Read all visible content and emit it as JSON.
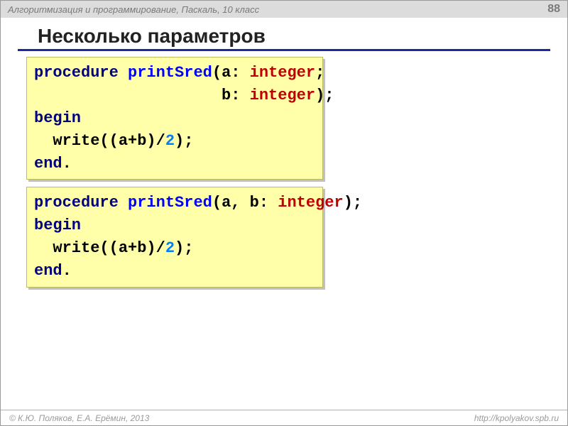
{
  "header": {
    "course": "Алгоритмизация и программирование, Паскаль, 10 класс",
    "page": "88"
  },
  "title": "Несколько параметров",
  "code1": {
    "l1": {
      "kw": "procedure",
      "sp1": " ",
      "id": "printSred",
      "p1": "(",
      "a": "a",
      "c1": ": ",
      "ty1": "integer",
      "sc": ";"
    },
    "l2": {
      "pad": "                    ",
      "b": "b",
      "c1": ": ",
      "ty1": "integer",
      "p2": ");"
    },
    "l3": {
      "kw": "begin"
    },
    "l4": {
      "pad": "  ",
      "call": "write((a+b)/",
      "num": "2",
      "tail": ");"
    },
    "l5": {
      "kw": "end",
      "dot": "."
    }
  },
  "code2": {
    "l1": {
      "kw": "procedure",
      "sp1": " ",
      "id": "printSred",
      "p1": "(",
      "a": "a",
      "cm": ", ",
      "b": "b",
      "c1": ": ",
      "ty1": "integer",
      "p2": ");"
    },
    "l2": {
      "kw": "begin"
    },
    "l3": {
      "pad": "  ",
      "call": "write((a+b)/",
      "num": "2",
      "tail": ");"
    },
    "l4": {
      "kw": "end",
      "dot": "."
    }
  },
  "footer": {
    "left": "© К.Ю. Поляков, Е.А. Ерёмин, 2013",
    "right": "http://kpolyakov.spb.ru"
  }
}
